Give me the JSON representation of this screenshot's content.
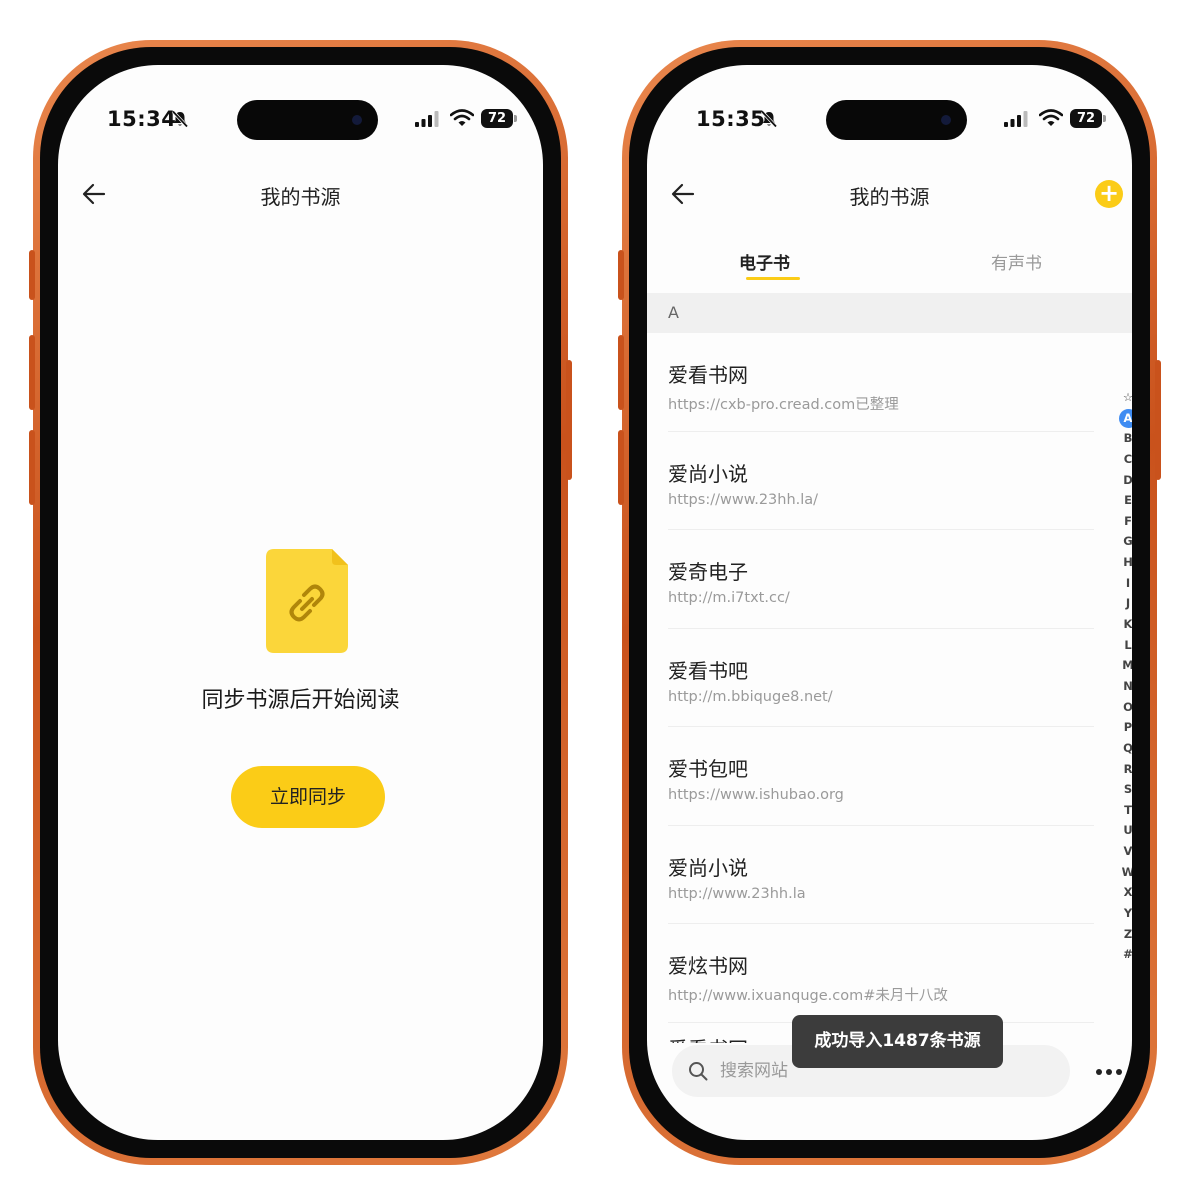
{
  "left_screen": {
    "status": {
      "time": "15:34",
      "battery": "72"
    },
    "nav": {
      "title": "我的书源"
    },
    "empty_state": {
      "message": "同步书源后开始阅读",
      "sync_button": "立即同步"
    }
  },
  "right_screen": {
    "status": {
      "time": "15:35",
      "battery": "72"
    },
    "nav": {
      "title": "我的书源",
      "add_icon": "+"
    },
    "tabs": [
      {
        "label": "电子书",
        "active": true
      },
      {
        "label": "有声书",
        "active": false
      }
    ],
    "section": "A",
    "sources": [
      {
        "name": "爱看书网",
        "url": "https://cxb-pro.cread.com已整理"
      },
      {
        "name": "爱尚小说",
        "url": "https://www.23hh.la/"
      },
      {
        "name": "爱奇电子",
        "url": "http://m.i7txt.cc/"
      },
      {
        "name": "爱看书吧",
        "url": "http://m.bbiquge8.net/"
      },
      {
        "name": "爱书包吧",
        "url": "https://www.ishubao.org"
      },
      {
        "name": "爱尚小说",
        "url": "http://www.23hh.la"
      },
      {
        "name": "爱炫书网",
        "url": "http://www.ixuanquge.com#未月十八改"
      }
    ],
    "partial_next_item": "爱看书网",
    "index_letters": [
      "☆",
      "A",
      "B",
      "C",
      "D",
      "E",
      "F",
      "G",
      "H",
      "I",
      "J",
      "K",
      "L",
      "M",
      "N",
      "O",
      "P",
      "Q",
      "R",
      "S",
      "T",
      "U",
      "V",
      "W",
      "X",
      "Y",
      "Z",
      "#"
    ],
    "active_index": "A",
    "search": {
      "placeholder": "搜索网站",
      "value": ""
    },
    "toast": "成功导入1487条书源"
  },
  "colors": {
    "accent": "#fbcc17",
    "index_active": "#3f8cf2",
    "frame": "#c9521c"
  }
}
